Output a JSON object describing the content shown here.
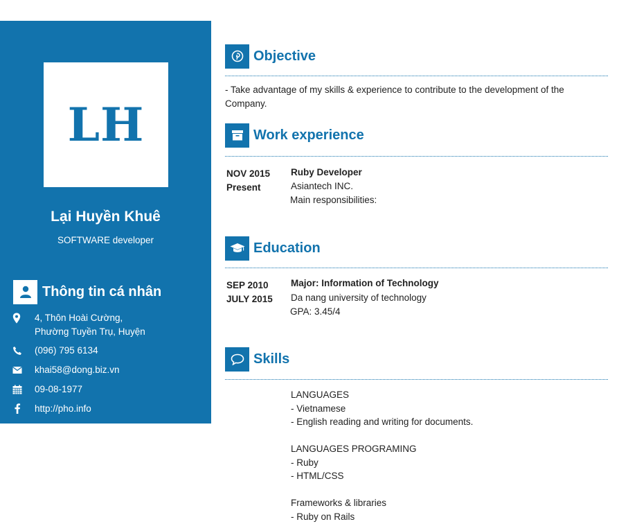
{
  "sidebar": {
    "avatar_initials": "LH",
    "name": "Lại Huyền Khuê",
    "title": "SOFTWARE developer",
    "personal_heading": "Thông tin cá nhân",
    "address_line1": "4, Thôn Hoài Cường,",
    "address_line2": "Phường Tuyền Trụ, Huyện",
    "phone": "(096) 795 6134",
    "email": "khai58@dong.biz.vn",
    "birthday": "09-08-1977",
    "website": "http://pho.info"
  },
  "objective": {
    "heading": "Objective",
    "line1": "- Take advantage of my skills & experience to contribute to the development of the",
    "line2": "Company."
  },
  "work": {
    "heading": "Work experience",
    "date_from": "NOV 2015",
    "date_to": "Present",
    "position": "Ruby Developer",
    "company": "Asiantech INC.",
    "detail": "Main responsibilities:"
  },
  "education": {
    "heading": "Education",
    "date_from": "SEP 2010",
    "date_to": "JULY 2015",
    "major": "Major: Information of Technology",
    "school": "Da nang university of technology",
    "gpa": "GPA: 3.45/4"
  },
  "skills": {
    "heading": "Skills",
    "lines": [
      "LANGUAGES",
      "- Vietnamese",
      "- English reading and writing for documents.",
      "",
      "LANGUAGES PROGRAMING",
      "- Ruby",
      "- HTML/CSS",
      "",
      "Frameworks & libraries",
      "- Ruby on Rails"
    ]
  },
  "colors": {
    "accent": "#1273ad",
    "text": "#222222"
  },
  "icons": [
    "user-icon",
    "map-marker-icon",
    "phone-icon",
    "envelope-icon",
    "calendar-icon",
    "facebook-icon",
    "pinterest-icon",
    "archive-icon",
    "graduation-cap-icon",
    "comment-icon"
  ]
}
